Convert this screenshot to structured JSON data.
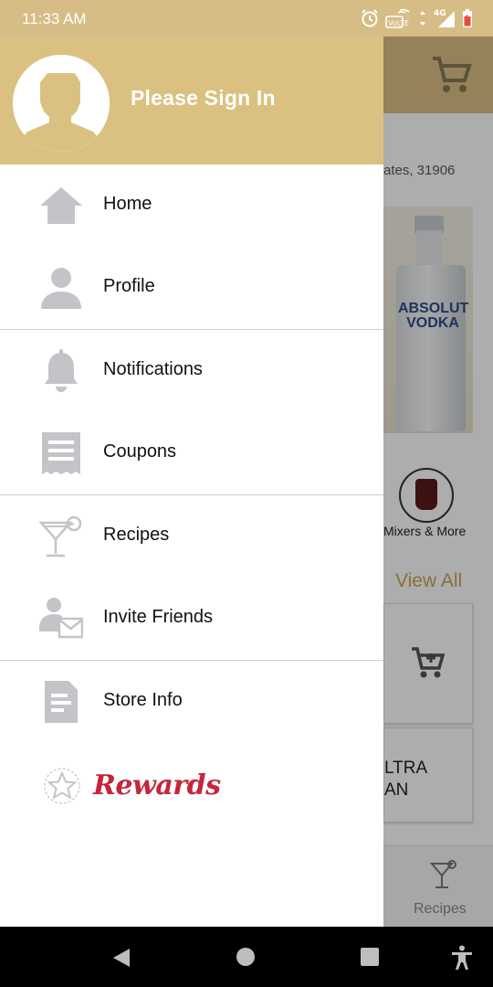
{
  "status_bar": {
    "time": "11:33 AM",
    "network": "4G"
  },
  "background": {
    "address_partial": "ates, 31906",
    "bottle_brand_line1": "ABSOLUT",
    "bottle_brand_line2": "VODKA",
    "category_label": "Mixers & More",
    "view_all": "View All",
    "card_text_line1": "LTRA",
    "card_text_line2": "AN",
    "bottom_nav_label": "Recipes"
  },
  "drawer": {
    "header_text": "Please Sign In",
    "items": [
      {
        "label": "Home",
        "icon": "home-icon"
      },
      {
        "label": "Profile",
        "icon": "profile-icon"
      },
      {
        "label": "Notifications",
        "icon": "bell-icon"
      },
      {
        "label": "Coupons",
        "icon": "coupon-icon"
      },
      {
        "label": "Recipes",
        "icon": "cocktail-icon"
      },
      {
        "label": "Invite Friends",
        "icon": "invite-icon"
      },
      {
        "label": "Store Info",
        "icon": "document-icon"
      }
    ],
    "rewards_label": "Rewards"
  },
  "colors": {
    "header": "#dbc181",
    "icon_gray": "#c4c4c8",
    "rewards_red": "#c4263a"
  }
}
